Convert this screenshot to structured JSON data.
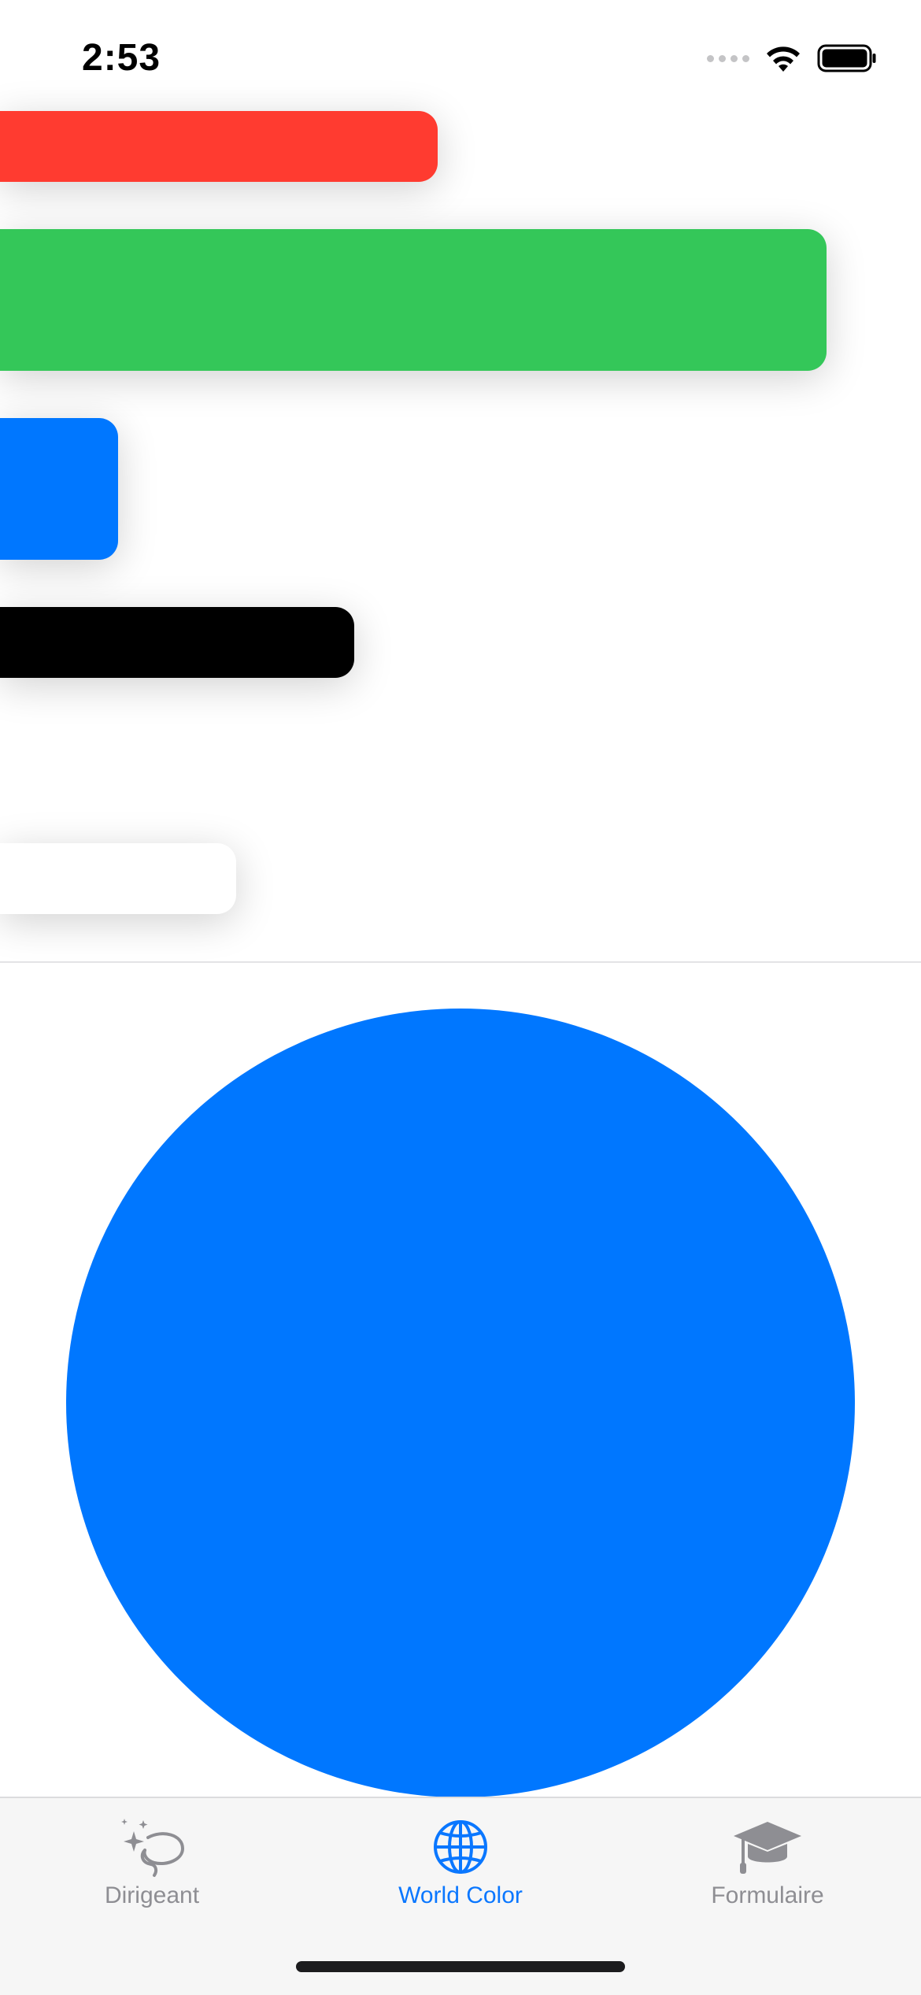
{
  "status_bar": {
    "time": "2:53",
    "icons": [
      "signal-icon",
      "wifi-icon",
      "battery-icon"
    ]
  },
  "colors": {
    "red": "#ff3b30",
    "green": "#34c759",
    "blue": "#0077ff",
    "black": "#000000",
    "white": "#ffffff",
    "tab_active": "#0a77ff",
    "tab_inactive": "#8e8e93"
  },
  "bars": [
    {
      "name": "red-bar",
      "color": "#ff3b30"
    },
    {
      "name": "green-bar",
      "color": "#34c759"
    },
    {
      "name": "blue-bar",
      "color": "#0077ff"
    },
    {
      "name": "black-bar",
      "color": "#000000"
    },
    {
      "name": "white-bar",
      "color": "#ffffff"
    }
  ],
  "circle": {
    "color": "#0077ff"
  },
  "tab_bar": {
    "tabs": [
      {
        "label": "Dirigeant",
        "icon": "sparkles-lasso-icon",
        "active": false
      },
      {
        "label": "World Color",
        "icon": "globe-icon",
        "active": true
      },
      {
        "label": "Formulaire",
        "icon": "graduation-cap-icon",
        "active": false
      }
    ]
  }
}
